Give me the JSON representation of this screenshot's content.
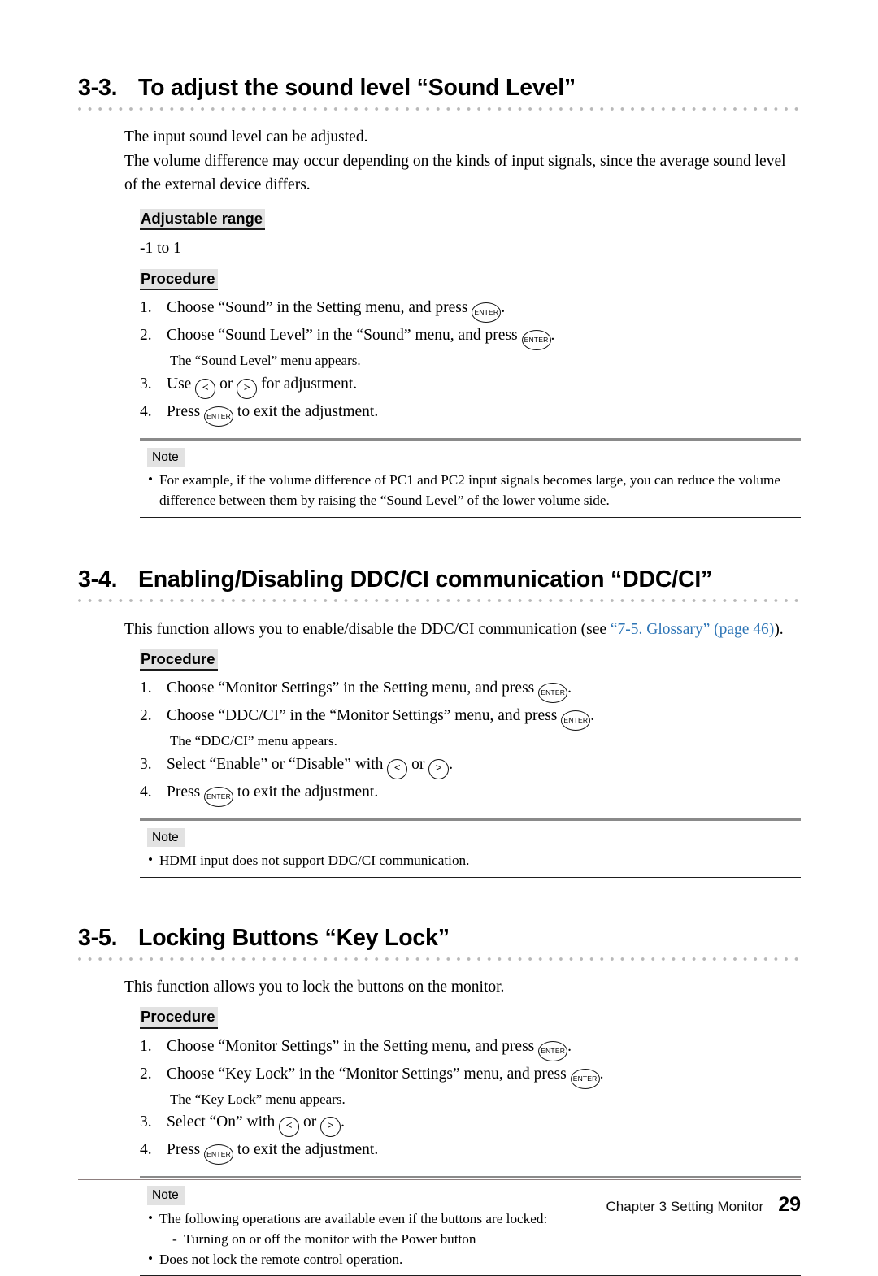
{
  "sections": [
    {
      "number": "3-3.",
      "title": "To adjust the sound level “Sound Level”",
      "intro": [
        "The input sound level can be adjusted.",
        "The volume difference may occur depending on the kinds of input signals, since the average sound level of the external device differs."
      ],
      "adjustable_range_label": "Adjustable range",
      "adjustable_range_value": "-1 to 1",
      "procedure_label": "Procedure",
      "steps": [
        {
          "num": "1.",
          "pre": "Choose “Sound” in the Setting menu, and press ",
          "key": "ENTER",
          "post": ".",
          "sub": ""
        },
        {
          "num": "2.",
          "pre": "Choose “Sound Level” in the “Sound” menu, and press ",
          "key": "ENTER",
          "post": ".",
          "sub": "The “Sound Level” menu appears."
        },
        {
          "num": "3.",
          "pre": "Use ",
          "key": "<",
          "mid": " or ",
          "key2": ">",
          "post": " for adjustment.",
          "sub": ""
        },
        {
          "num": "4.",
          "pre": "Press ",
          "key": "ENTER",
          "post": " to exit the adjustment.",
          "sub": ""
        }
      ],
      "note_label": "Note",
      "notes": [
        "For example, if the volume difference of PC1 and PC2 input signals becomes large, you can reduce the volume difference between them by raising the “Sound Level” of the lower volume side."
      ]
    },
    {
      "number": "3-4.",
      "title": "Enabling/Disabling DDC/CI communication “DDC/CI”",
      "intro_pre": "This function allows you to enable/disable the DDC/CI communication (see ",
      "intro_link": "“7-5. Glossary” (page 46)",
      "intro_post": ").",
      "procedure_label": "Procedure",
      "steps": [
        {
          "num": "1.",
          "pre": "Choose “Monitor Settings” in the Setting menu, and press ",
          "key": "ENTER",
          "post": ".",
          "sub": ""
        },
        {
          "num": "2.",
          "pre": "Choose “DDC/CI” in the “Monitor Settings” menu, and press ",
          "key": "ENTER",
          "post": ".",
          "sub": "The “DDC/CI” menu appears."
        },
        {
          "num": "3.",
          "pre": "Select “Enable” or “Disable” with ",
          "key": "<",
          "mid": " or ",
          "key2": ">",
          "post": ".",
          "sub": ""
        },
        {
          "num": "4.",
          "pre": "Press ",
          "key": "ENTER",
          "post": " to exit the adjustment.",
          "sub": ""
        }
      ],
      "note_label": "Note",
      "notes": [
        "HDMI input does not support DDC/CI communication."
      ]
    },
    {
      "number": "3-5.",
      "title": "Locking Buttons “Key Lock”",
      "intro": [
        "This function allows you to lock the buttons on the monitor."
      ],
      "procedure_label": "Procedure",
      "steps": [
        {
          "num": "1.",
          "pre": "Choose “Monitor Settings” in the Setting menu, and press ",
          "key": "ENTER",
          "post": ".",
          "sub": ""
        },
        {
          "num": "2.",
          "pre": "Choose “Key Lock” in the “Monitor Settings” menu, and press ",
          "key": "ENTER",
          "post": ".",
          "sub": "The “Key Lock” menu appears."
        },
        {
          "num": "3.",
          "pre": "Select “On” with ",
          "key": "<",
          "mid": " or ",
          "key2": ">",
          "post": ".",
          "sub": ""
        },
        {
          "num": "4.",
          "pre": "Press ",
          "key": "ENTER",
          "post": " to exit the adjustment.",
          "sub": ""
        }
      ],
      "note_label": "Note",
      "notes_structured": [
        {
          "text": "The following operations are available even if the buttons are locked:",
          "subitems": [
            "Turning on or off the monitor with the Power button"
          ]
        },
        {
          "text": "Does not lock the remote control operation.",
          "subitems": []
        }
      ]
    }
  ],
  "footer": {
    "chapter": "Chapter 3 Setting Monitor",
    "page": "29"
  },
  "colors": {
    "link": "#2e75b6",
    "highlight": "#e2e2e2",
    "dot_rule": "#b8b8b8",
    "note_top_rule": "#8a8a8a",
    "note_bottom_rule": "#1d1d1d",
    "footer_rule": "#8d7f7f"
  },
  "icons": {
    "enter_key": "enter-key-icon",
    "left_key": "left-arrow-key-icon",
    "right_key": "right-arrow-key-icon",
    "bullet": "•",
    "dash": "-"
  }
}
